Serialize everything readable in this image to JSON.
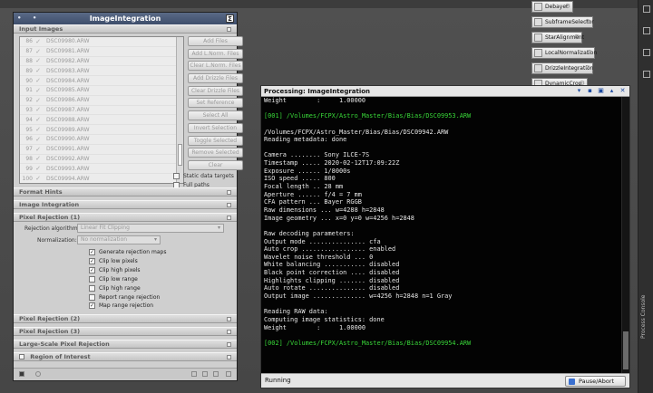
{
  "ii_window": {
    "title": "ImageIntegration",
    "sigma_label": "Σ",
    "sections": {
      "input_images": "Input Images",
      "format_hints": "Format Hints",
      "image_integration": "Image Integration",
      "pixel_rejection_1": "Pixel Rejection (1)",
      "pixel_rejection_2": "Pixel Rejection (2)",
      "pixel_rejection_3": "Pixel Rejection (3)",
      "large_scale": "Large-Scale Pixel Rejection",
      "region_of_interest": "Region of Interest"
    },
    "files": [
      {
        "num": "86",
        "name": "DSC09980.ARW"
      },
      {
        "num": "87",
        "name": "DSC09981.ARW"
      },
      {
        "num": "88",
        "name": "DSC09982.ARW"
      },
      {
        "num": "89",
        "name": "DSC09983.ARW"
      },
      {
        "num": "90",
        "name": "DSC09984.ARW"
      },
      {
        "num": "91",
        "name": "DSC09985.ARW"
      },
      {
        "num": "92",
        "name": "DSC09986.ARW"
      },
      {
        "num": "93",
        "name": "DSC09987.ARW"
      },
      {
        "num": "94",
        "name": "DSC09988.ARW"
      },
      {
        "num": "95",
        "name": "DSC09989.ARW"
      },
      {
        "num": "96",
        "name": "DSC09990.ARW"
      },
      {
        "num": "97",
        "name": "DSC09991.ARW"
      },
      {
        "num": "98",
        "name": "DSC09992.ARW"
      },
      {
        "num": "99",
        "name": "DSC09993.ARW"
      },
      {
        "num": "100",
        "name": "DSC09994.ARW"
      }
    ],
    "buttons": [
      "Add Files",
      "Add L.Norm. Files",
      "Clear L.Norm. Files",
      "Add Drizzle Files",
      "Clear Drizzle Files",
      "Set Reference",
      "Select All",
      "Invert Selection",
      "Toggle Selected",
      "Remove Selected",
      "Clear"
    ],
    "static_targets": "Static data targets",
    "full_paths": "Full paths",
    "rejection_algorithm_label": "Rejection algorithm:",
    "rejection_algorithm_value": "Linear Fit Clipping",
    "normalization_label": "Normalization:",
    "normalization_value": "No normalization",
    "options": [
      {
        "label": "Generate rejection maps",
        "checked": true
      },
      {
        "label": "Clip low pixels",
        "checked": true
      },
      {
        "label": "Clip high pixels",
        "checked": true
      },
      {
        "label": "Clip low range",
        "checked": false
      },
      {
        "label": "Clip high range",
        "checked": false
      },
      {
        "label": "Report range rejection",
        "checked": false
      },
      {
        "label": "Map range rejection",
        "checked": true
      }
    ]
  },
  "console": {
    "title": "Processing: ImageIntegration",
    "lines": [
      {
        "t": "Weight        :     1.00000",
        "c": "w"
      },
      {
        "t": "",
        "c": "w"
      },
      {
        "t": "[001] /Volumes/FCPX/Astro_Master/Bias/Bias/DSC09953.ARW",
        "c": "g"
      },
      {
        "t": "",
        "c": "w"
      },
      {
        "t": "/Volumes/FCPX/Astro_Master/Bias/Bias/DSC09942.ARW",
        "c": "w"
      },
      {
        "t": "Reading metadata: done",
        "c": "w"
      },
      {
        "t": "",
        "c": "w"
      },
      {
        "t": "Camera ........ Sony ILCE-7S",
        "c": "w"
      },
      {
        "t": "Timestamp ..... 2020-02-12T17:09:22Z",
        "c": "w"
      },
      {
        "t": "Exposure ...... 1/8000s",
        "c": "w"
      },
      {
        "t": "ISO speed ..... 800",
        "c": "w"
      },
      {
        "t": "Focal length .. 28 mm",
        "c": "w"
      },
      {
        "t": "Aperture ...... f/4 = 7 mm",
        "c": "w"
      },
      {
        "t": "CFA pattern ... Bayer RGGB",
        "c": "w"
      },
      {
        "t": "Raw dimensions ... w=4288 h=2848",
        "c": "w"
      },
      {
        "t": "Image geometry ... x=0 y=0 w=4256 h=2848",
        "c": "w"
      },
      {
        "t": "",
        "c": "w"
      },
      {
        "t": "Raw decoding parameters:",
        "c": "w"
      },
      {
        "t": "Output mode ............... cfa",
        "c": "w"
      },
      {
        "t": "Auto crop ................. enabled",
        "c": "w"
      },
      {
        "t": "Wavelet noise threshold ... 0",
        "c": "w"
      },
      {
        "t": "White balancing ........... disabled",
        "c": "w"
      },
      {
        "t": "Black point correction .... disabled",
        "c": "w"
      },
      {
        "t": "Highlights clipping ....... disabled",
        "c": "w"
      },
      {
        "t": "Auto rotate ............... disabled",
        "c": "w"
      },
      {
        "t": "Output image .............. w=4256 h=2848 n=1 Gray",
        "c": "w"
      },
      {
        "t": "",
        "c": "w"
      },
      {
        "t": "Reading RAW data:",
        "c": "w"
      },
      {
        "t": "Computing image statistics: done",
        "c": "w"
      },
      {
        "t": "Weight        :     1.00000",
        "c": "w"
      },
      {
        "t": "",
        "c": "w"
      },
      {
        "t": "[002] /Volumes/FCPX/Astro_Master/Bias/Bias/DSC09954.ARW",
        "c": "g"
      }
    ],
    "status": "Running",
    "pause_label": "Pause/Abort"
  },
  "processes": [
    {
      "label": "Debayer",
      "dim": false
    },
    {
      "label": "SubframeSelector",
      "dim": false
    },
    {
      "label": "StarAlignment",
      "dim": false
    },
    {
      "label": "LocalNormalization",
      "dim": false
    },
    {
      "label": "DrizzleIntegration",
      "dim": false
    },
    {
      "label": "DynamicCrop",
      "dim": false
    }
  ],
  "right_panel_label": "Process Console",
  "colors": {
    "console_green": "#38d638",
    "title_bar": "#4a5a78",
    "pause_icon": "#3a70d0"
  }
}
